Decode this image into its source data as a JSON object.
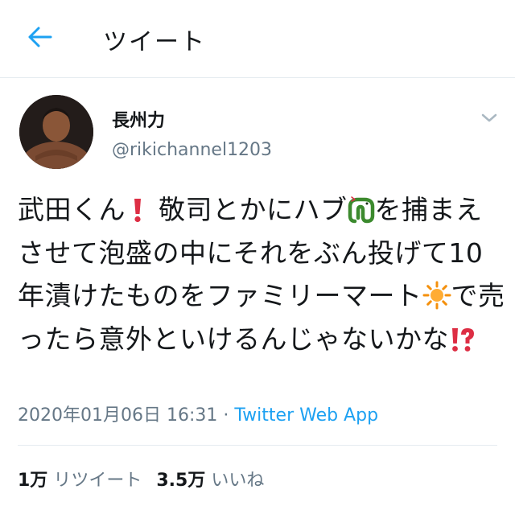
{
  "header": {
    "title": "ツイート",
    "back_icon": "arrow-left-icon",
    "accent_color": "#1da1f2"
  },
  "author": {
    "display_name": "長州力",
    "handle": "@rikichannel1203"
  },
  "tweet": {
    "segments": [
      "武田くん",
      "敬司とかにハブ",
      "を捕まえさせて泡盛の中にそれをぶん投げて10年漬けたものをファミリーマート",
      "で売ったら意外といけるんじゃないかな"
    ],
    "emojis": [
      "exclamation-icon",
      "snake-icon",
      "sun-icon",
      "exclamation-question-icon"
    ],
    "timestamp": "2020年01月06日 16:31",
    "separator": "·",
    "source": "Twitter Web App"
  },
  "stats": {
    "retweets_count": "1万",
    "retweets_label": "リツイート",
    "likes_count": "3.5万",
    "likes_label": "いいね"
  }
}
